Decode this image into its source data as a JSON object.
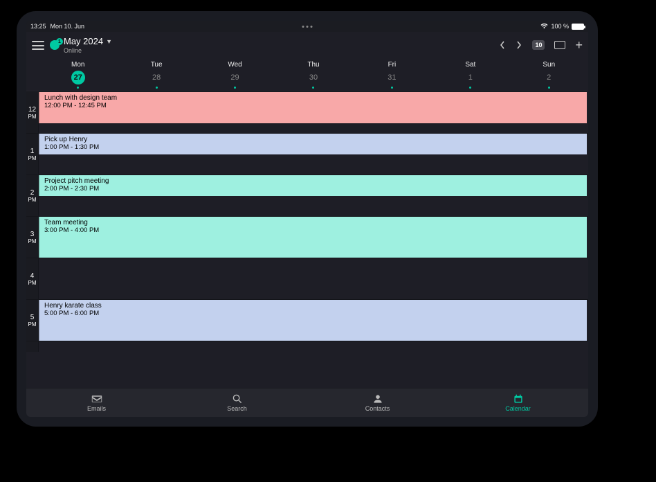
{
  "status_bar": {
    "time": "13:25",
    "date": "Mon 10. Jun",
    "battery_text": "100 %"
  },
  "header": {
    "month_title": "May 2024",
    "online_status": "Online",
    "today_badge": "10",
    "logo_badge": "1"
  },
  "week": {
    "days": [
      {
        "name": "Mon",
        "number": "27",
        "selected": true,
        "hasDot": true
      },
      {
        "name": "Tue",
        "number": "28",
        "selected": false,
        "hasDot": true
      },
      {
        "name": "Wed",
        "number": "29",
        "selected": false,
        "hasDot": true
      },
      {
        "name": "Thu",
        "number": "30",
        "selected": false,
        "hasDot": true
      },
      {
        "name": "Fri",
        "number": "31",
        "selected": false,
        "hasDot": true
      },
      {
        "name": "Sat",
        "number": "1",
        "selected": false,
        "hasDot": true
      },
      {
        "name": "Sun",
        "number": "2",
        "selected": false,
        "hasDot": true
      }
    ]
  },
  "time_labels": {
    "h12": {
      "num": "12",
      "ampm": "PM"
    },
    "h1": {
      "num": "1",
      "ampm": "PM"
    },
    "h2": {
      "num": "2",
      "ampm": "PM"
    },
    "h3": {
      "num": "3",
      "ampm": "PM"
    },
    "h4": {
      "num": "4",
      "ampm": "PM"
    },
    "h5": {
      "num": "5",
      "ampm": "PM"
    }
  },
  "events": {
    "lunch": {
      "title": "Lunch with design team",
      "time": "12:00 PM - 12:45 PM"
    },
    "pickup": {
      "title": "Pick up Henry",
      "time": "1:00 PM - 1:30 PM"
    },
    "pitch": {
      "title": "Project pitch meeting",
      "time": "2:00 PM - 2:30 PM"
    },
    "team": {
      "title": "Team meeting",
      "time": "3:00 PM - 4:00 PM"
    },
    "karate": {
      "title": "Henry karate class",
      "time": "5:00 PM - 6:00 PM"
    }
  },
  "bottom_nav": {
    "emails": "Emails",
    "search": "Search",
    "contacts": "Contacts",
    "calendar": "Calendar"
  }
}
